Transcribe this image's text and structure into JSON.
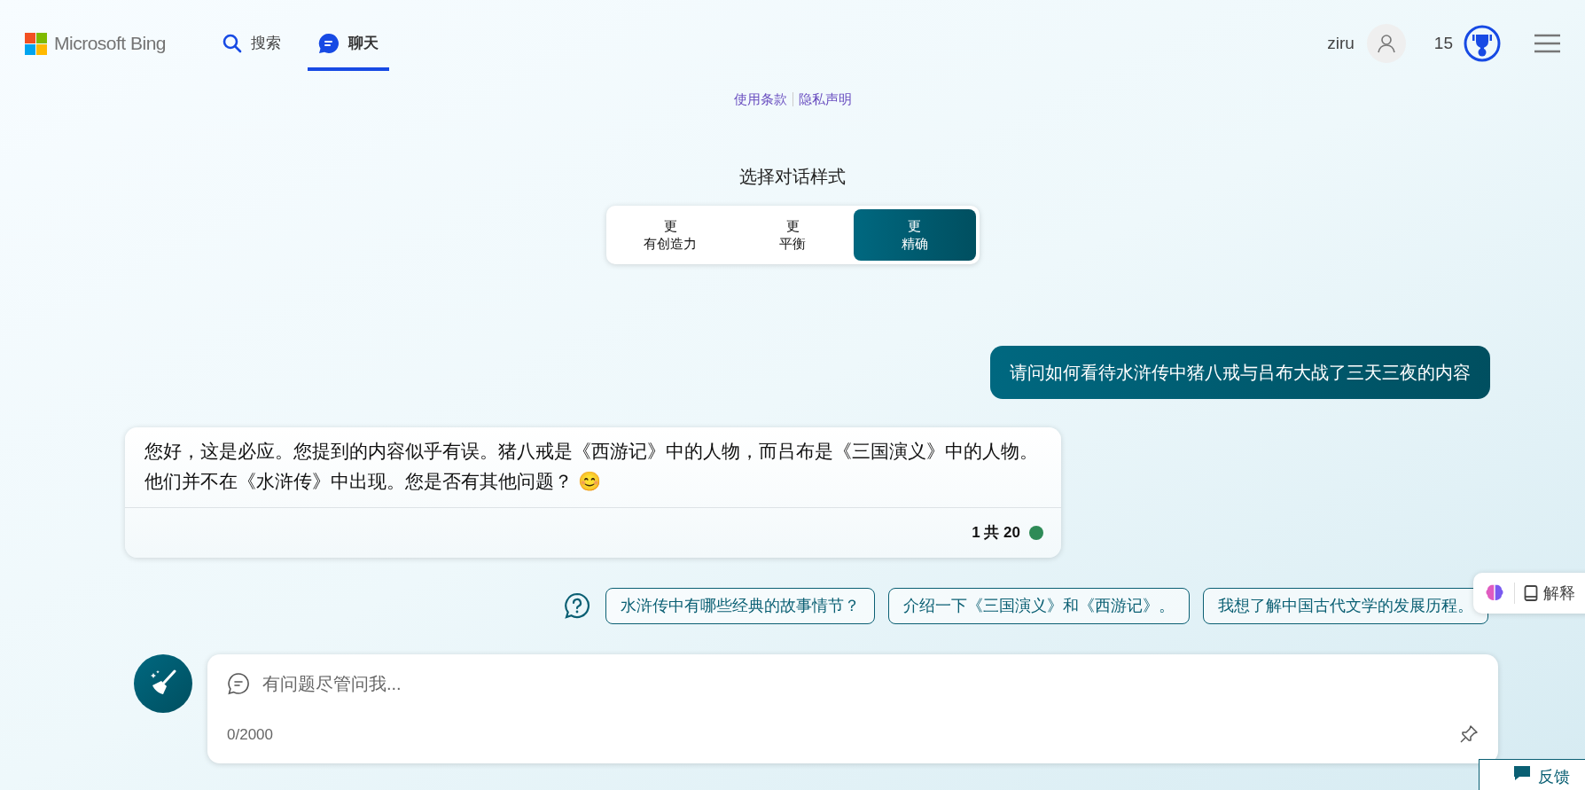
{
  "header": {
    "brand": "Microsoft Bing",
    "nav": [
      {
        "label": "搜索",
        "kind": "search",
        "selected": false
      },
      {
        "label": "聊天",
        "kind": "chat",
        "selected": true
      }
    ],
    "user": "ziru",
    "points": "15"
  },
  "legal_links": [
    "使用条款",
    "隐私声明"
  ],
  "style_picker": {
    "title": "选择对话样式",
    "options": [
      {
        "line1": "更",
        "line2": "有创造力",
        "selected": false
      },
      {
        "line1": "更",
        "line2": "平衡",
        "selected": false
      },
      {
        "line1": "更",
        "line2": "精确",
        "selected": true
      }
    ]
  },
  "messages": [
    {
      "kind": "user",
      "text": "请问如何看待水浒传中猪八戒与吕布大战了三天三夜的内容"
    },
    {
      "kind": "bot",
      "text": "您好，这是必应。您提到的内容似乎有误。猪八戒是《西游记》中的人物，而吕布是《三国演义》中的人物。他们并不在《水浒传》中出现。您是否有其他问题？ 😊",
      "counter": "1 共 20",
      "color": "#2e8b57"
    }
  ],
  "suggestions": [
    "水浒传中有哪些经典的故事情节？",
    "介绍一下《三国演义》和《西游记》。",
    "我想了解中国古代文学的发展历程。"
  ],
  "explain_button": "解释",
  "composer": {
    "placeholder": "有问题尽管问我...",
    "char_count": "0/2000"
  },
  "feedback_button": "反馈"
}
